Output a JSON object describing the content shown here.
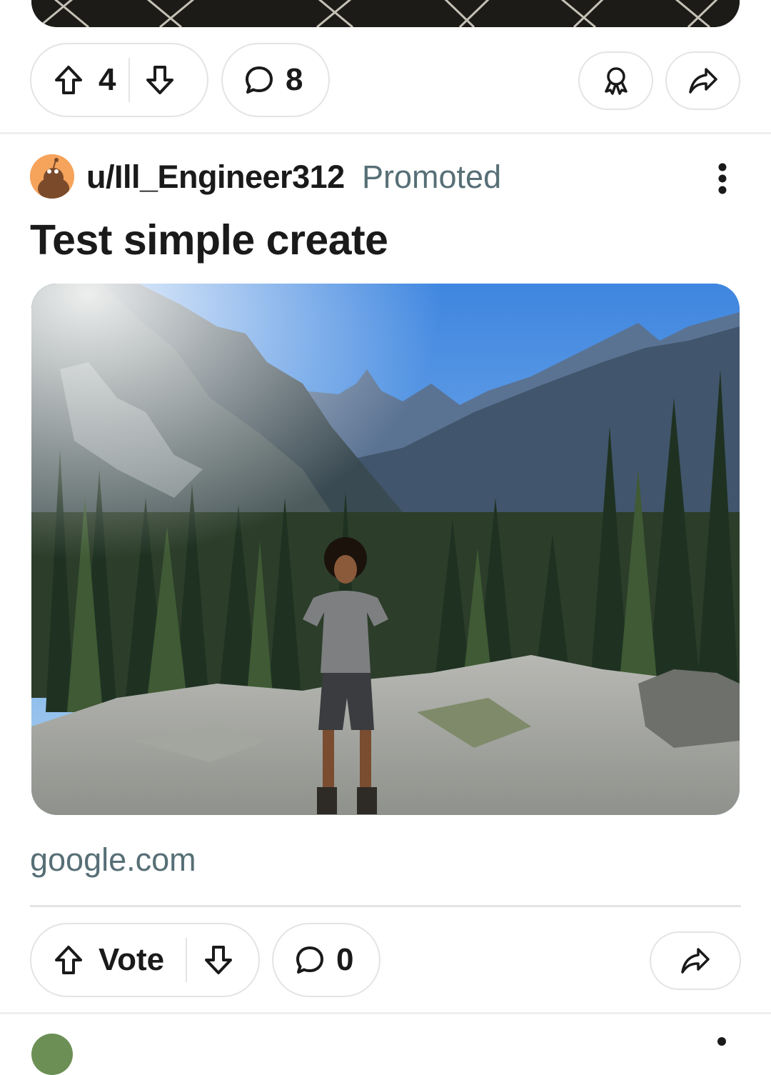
{
  "prev_post": {
    "vote_count": "4",
    "comment_count": "8",
    "icons": {
      "upvote": "arrow-up-outline",
      "downvote": "arrow-down-outline",
      "comment": "speech-bubble",
      "award": "award-ribbon",
      "share": "share-arrow"
    }
  },
  "post": {
    "username": "u/Ill_Engineer312",
    "promoted_label": "Promoted",
    "title": "Test simple create",
    "link_domain": "google.com",
    "vote_label": "Vote",
    "comment_count": "0",
    "icons": {
      "avatar": "snoo-avatar",
      "menu": "more-vertical",
      "upvote": "arrow-up-outline",
      "downvote": "arrow-down-outline",
      "comment": "speech-bubble",
      "share": "share-arrow"
    },
    "image_subject": "hiker standing on granite rock with forested mountain valley behind"
  },
  "colors": {
    "text_primary": "#1a1a1b",
    "text_secondary": "#576f76",
    "border": "#e2e4e6",
    "avatar_bg": "#f6a35b"
  }
}
